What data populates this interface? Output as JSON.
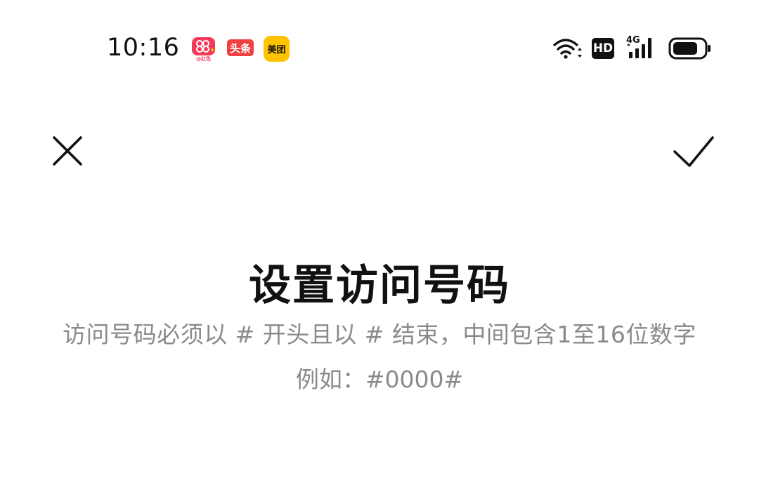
{
  "status_bar": {
    "time": "10:16",
    "notification_apps": [
      {
        "name": "hongse-app-icon",
        "label": "@红色"
      },
      {
        "name": "toutiao-app-icon",
        "label": "头条"
      },
      {
        "name": "meituan-app-icon",
        "label": "美团"
      }
    ],
    "hd_label": "HD",
    "network_label": "4G"
  },
  "toolbar": {
    "close_icon": "close-icon",
    "confirm_icon": "check-icon"
  },
  "content": {
    "title": "设置访问号码",
    "hint": "访问号码必须以 # 开头且以 # 结束，中间包含1至16位数字",
    "example": "例如：#0000#"
  }
}
